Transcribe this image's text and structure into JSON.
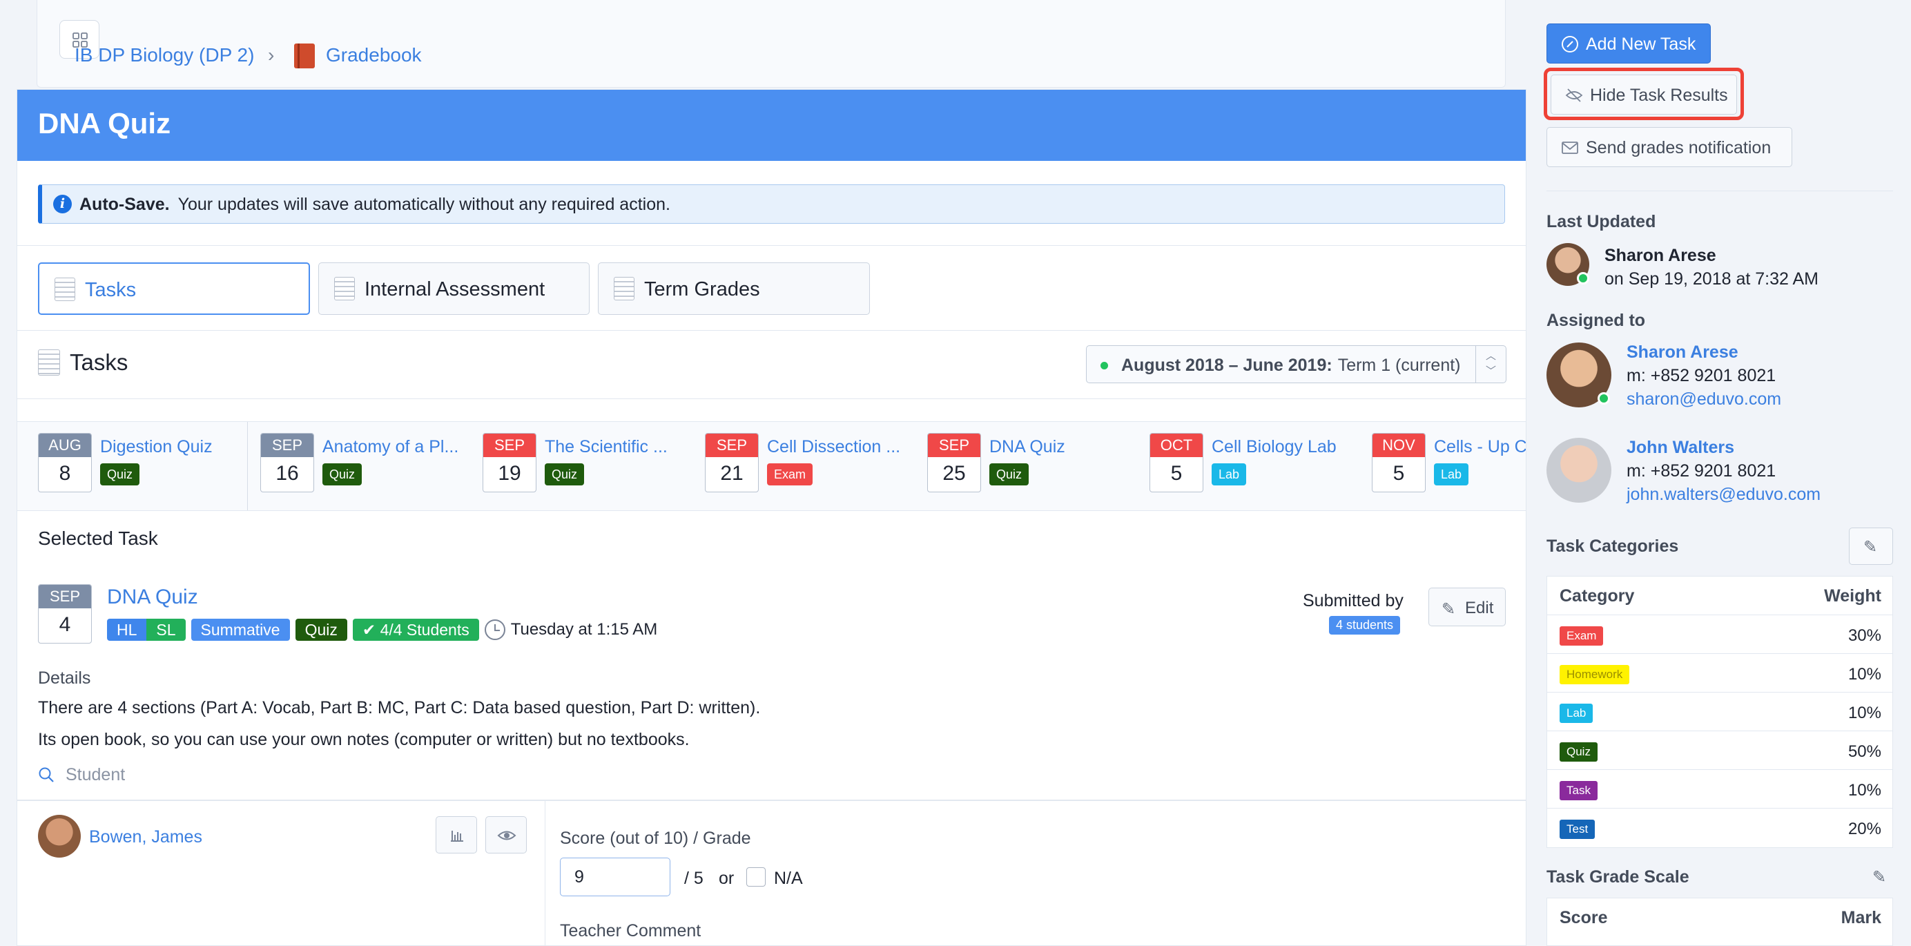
{
  "breadcrumb": {
    "course": "IB DP Biology (DP 2)",
    "separator": "›",
    "gradebook": "Gradebook"
  },
  "page": {
    "title": "DNA Quiz"
  },
  "autosave": {
    "label": "Auto-Save.",
    "message": "Your updates will save automatically without any required action.",
    "icon": "info-icon"
  },
  "tabs": [
    {
      "label": "Tasks",
      "active": true
    },
    {
      "label": "Internal Assessment",
      "active": false
    },
    {
      "label": "Term Grades",
      "active": false
    }
  ],
  "tasks_section": {
    "heading": "Tasks",
    "term_bold": "August 2018 – June 2019:",
    "term_rest": "Term 1 (current)"
  },
  "task_strip": [
    {
      "month": "AUG",
      "day": "8",
      "name": "Digestion Quiz",
      "badge": "Quiz",
      "month_color": "#7d8da6",
      "badge_color": "#1f5b0d"
    },
    {
      "month": "SEP",
      "day": "16",
      "name": "Anatomy of a Pl...",
      "badge": "Quiz",
      "month_color": "#7d8da6",
      "badge_color": "#1f5b0d"
    },
    {
      "month": "SEP",
      "day": "19",
      "name": "The Scientific ...",
      "badge": "Quiz",
      "month_color": "#f04848",
      "badge_color": "#1f5b0d"
    },
    {
      "month": "SEP",
      "day": "21",
      "name": "Cell Dissection ...",
      "badge": "Exam",
      "month_color": "#f04848",
      "badge_color": "#f04848"
    },
    {
      "month": "SEP",
      "day": "25",
      "name": "DNA Quiz",
      "badge": "Quiz",
      "month_color": "#f04848",
      "badge_color": "#1f5b0d"
    },
    {
      "month": "OCT",
      "day": "5",
      "name": "Cell Biology Lab",
      "badge": "Lab",
      "month_color": "#f04848",
      "badge_color": "#1ab8e8"
    },
    {
      "month": "NOV",
      "day": "5",
      "name": "Cells - Up C",
      "badge": "Lab",
      "month_color": "#f04848",
      "badge_color": "#1ab8e8"
    }
  ],
  "selected_task": {
    "heading": "Selected Task",
    "month": "SEP",
    "day": "4",
    "name": "DNA Quiz",
    "levels": [
      "HL",
      "SL"
    ],
    "type": "Summative",
    "category": "Quiz",
    "students": "4/4 Students",
    "when": "Tuesday at 1:15 AM",
    "submitted_by_label": "Submitted by",
    "submitted_count": "4 students",
    "edit_label": "Edit",
    "details_label": "Details",
    "details_lines": [
      "There are 4 sections (Part A: Vocab, Part B: MC, Part C: Data based question, Part D: written).",
      "Its open book, so you can use your own notes (computer or written) but no textbooks."
    ],
    "student_search_placeholder": "Student"
  },
  "student_row": {
    "name": "Bowen, James",
    "score_label": "Score (out of 10) / Grade",
    "score_value": "9",
    "out_of": "/ 5",
    "or": "or",
    "na_label": "N/A",
    "comment_label": "Teacher Comment"
  },
  "sidebar": {
    "add_task": "Add New Task",
    "hide_results": "Hide Task Results",
    "send_notification": "Send grades notification",
    "last_updated": {
      "heading": "Last Updated",
      "name": "Sharon Arese",
      "date": "on Sep 19, 2018 at 7:32 AM"
    },
    "assigned_to": {
      "heading": "Assigned to",
      "people": [
        {
          "name": "Sharon Arese",
          "phone": "m: +852 9201 8021",
          "email": "sharon@eduvo.com"
        },
        {
          "name": "John Walters",
          "phone": "m: +852 9201 8021",
          "email": "john.walters@eduvo.com"
        }
      ]
    },
    "task_categories": {
      "heading": "Task Categories",
      "col_category": "Category",
      "col_weight": "Weight",
      "rows": [
        {
          "category": "Exam",
          "weight": "30%",
          "color": "#f04848",
          "text_color": "#ffffff"
        },
        {
          "category": "Homework",
          "weight": "10%",
          "color": "#fff200",
          "text_color": "#9a8f00"
        },
        {
          "category": "Lab",
          "weight": "10%",
          "color": "#1ab8e8",
          "text_color": "#ffffff"
        },
        {
          "category": "Quiz",
          "weight": "50%",
          "color": "#1f5b0d",
          "text_color": "#ffffff"
        },
        {
          "category": "Task",
          "weight": "10%",
          "color": "#8a2a9c",
          "text_color": "#ffffff"
        },
        {
          "category": "Test",
          "weight": "20%",
          "color": "#1566b8",
          "text_color": "#ffffff"
        }
      ]
    },
    "grade_scale": {
      "heading": "Task Grade Scale",
      "col_score": "Score",
      "col_mark": "Mark"
    }
  },
  "colors": {
    "accent": "#4b8ff1",
    "link": "#3b7fe0",
    "success": "#22c35e",
    "highlight_ring": "#ee4136"
  }
}
